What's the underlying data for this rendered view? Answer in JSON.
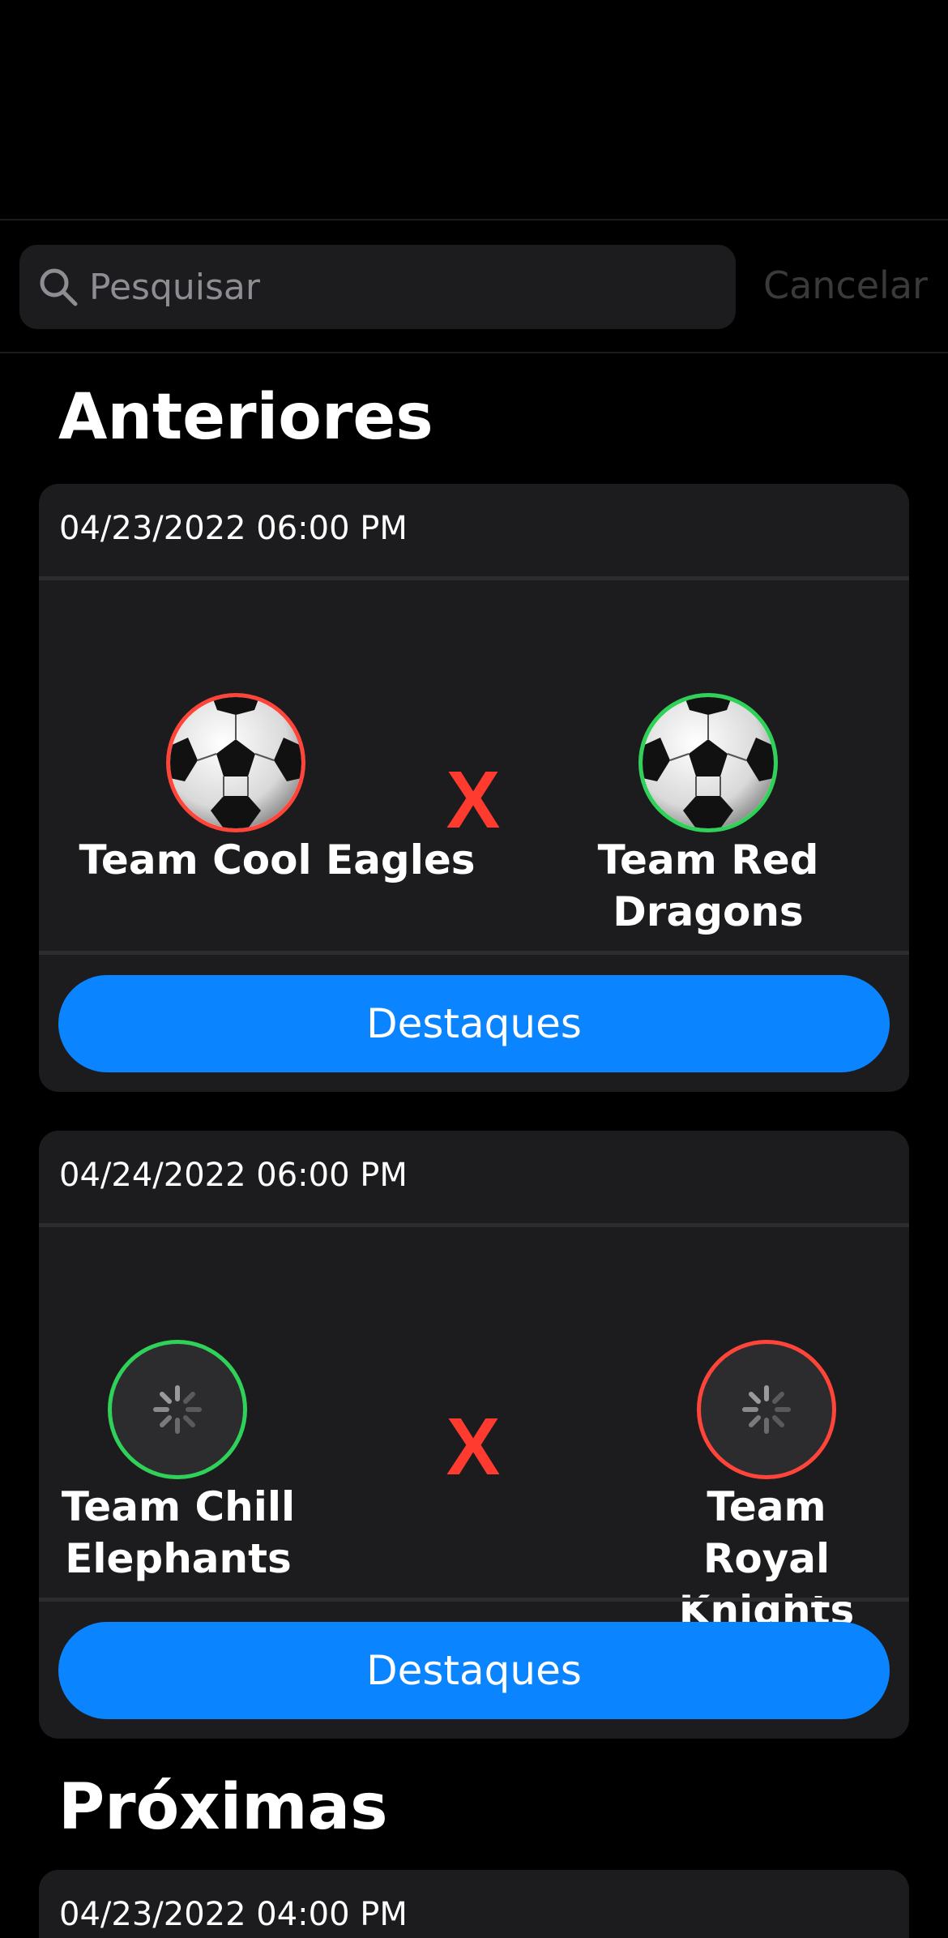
{
  "search": {
    "placeholder": "Pesquisar",
    "cancel_label": "Cancelar",
    "icon": "magnifying-glass-icon"
  },
  "sections": {
    "past_title": "Anteriores",
    "upcoming_title": "Próximas"
  },
  "past_matches": [
    {
      "date": "04/23/2022 06:00 PM",
      "home": {
        "name": "Team Cool Eagles",
        "logo": "soccer-ball",
        "ring": "#ff453a"
      },
      "versus": "X",
      "away": {
        "name": "Team Red Dragons",
        "logo": "soccer-ball",
        "ring": "#30d158"
      },
      "button_label": "Destaques"
    },
    {
      "date": "04/24/2022 06:00 PM",
      "home": {
        "name": "Team Chill Elephants",
        "logo": "loading-spinner",
        "ring": "#30d158"
      },
      "versus": "X",
      "away": {
        "name": "Team Royal Knights",
        "logo": "loading-spinner",
        "ring": "#ff453a"
      },
      "button_label": "Destaques"
    }
  ],
  "upcoming_matches": [
    {
      "date": "04/23/2022 04:00 PM"
    }
  ],
  "colors": {
    "background": "#000000",
    "card": "#1c1c1e",
    "accent_blue": "#0a84ff",
    "versus_red": "#ff3b30",
    "win_green": "#30d158",
    "loss_red": "#ff453a"
  }
}
